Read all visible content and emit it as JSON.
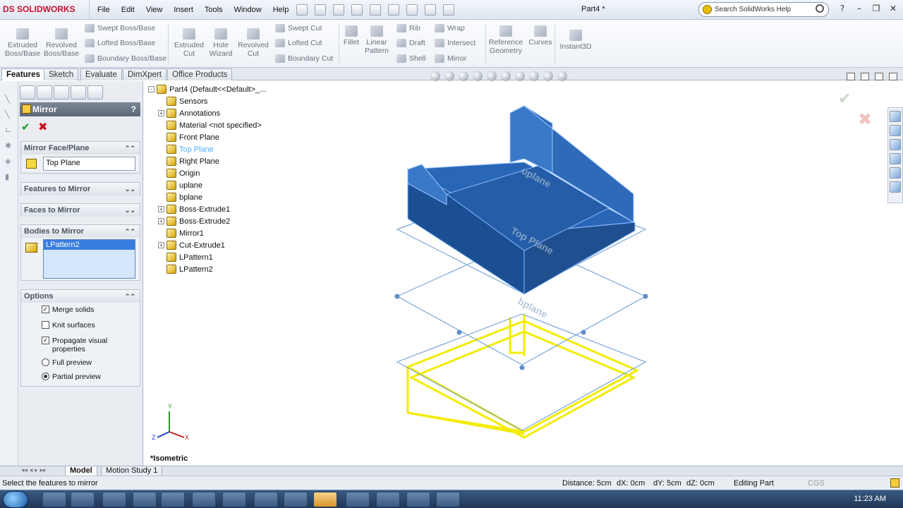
{
  "app": {
    "logo": "SOLIDWORKS",
    "document_title": "Part4 *"
  },
  "menu": [
    "File",
    "Edit",
    "View",
    "Insert",
    "Tools",
    "Window",
    "Help"
  ],
  "search": {
    "placeholder": "Search SolidWorks Help"
  },
  "ribbon": {
    "extruded_boss": "Extruded Boss/Base",
    "revolved_boss": "Revolved Boss/Base",
    "swept_boss": "Swept Boss/Base",
    "lofted_boss": "Lofted Boss/Base",
    "boundary_boss": "Boundary Boss/Base",
    "extruded_cut": "Extruded Cut",
    "hole_wizard": "Hole Wizard",
    "revolved_cut": "Revolved Cut",
    "swept_cut": "Swept Cut",
    "lofted_cut": "Lofted Cut",
    "boundary_cut": "Boundary Cut",
    "fillet": "Fillet",
    "linear_pattern": "Linear Pattern",
    "rib": "Rib",
    "draft": "Draft",
    "shell": "Shell",
    "wrap": "Wrap",
    "intersect": "Intersect",
    "mirror": "Mirror",
    "reference_geometry": "Reference Geometry",
    "curves": "Curves",
    "instant3d": "Instant3D"
  },
  "command_tabs": [
    "Features",
    "Sketch",
    "Evaluate",
    "DimXpert",
    "Office Products"
  ],
  "property_manager": {
    "title": "Mirror",
    "help": "?",
    "mirror_face_plane": {
      "label": "Mirror Face/Plane",
      "value": "Top Plane"
    },
    "features_to_mirror": "Features to Mirror",
    "faces_to_mirror": "Faces to Mirror",
    "bodies_to_mirror": {
      "label": "Bodies to Mirror",
      "items": [
        "LPattern2"
      ]
    },
    "options": {
      "label": "Options",
      "merge_solids": "Merge solids",
      "knit_surfaces": "Knit surfaces",
      "propagate": "Propagate visual properties",
      "full_preview": "Full preview",
      "partial_preview": "Partial preview"
    }
  },
  "tree": [
    {
      "label": "Part4  (Default<<Default>_...",
      "expander": "-"
    },
    {
      "label": "Sensors",
      "expander": ""
    },
    {
      "label": "Annotations",
      "expander": "+"
    },
    {
      "label": "Material <not specified>",
      "expander": ""
    },
    {
      "label": "Front Plane",
      "expander": ""
    },
    {
      "label": "Top Plane",
      "expander": ""
    },
    {
      "label": "Right Plane",
      "expander": ""
    },
    {
      "label": "Origin",
      "expander": ""
    },
    {
      "label": "uplane",
      "expander": ""
    },
    {
      "label": "bplane",
      "expander": ""
    },
    {
      "label": "Boss-Extrude1",
      "expander": "+"
    },
    {
      "label": "Boss-Extrude2",
      "expander": "+"
    },
    {
      "label": "Mirror1",
      "expander": ""
    },
    {
      "label": "Cut-Extrude1",
      "expander": "+"
    },
    {
      "label": "LPattern1",
      "expander": ""
    },
    {
      "label": "LPattern2",
      "expander": ""
    }
  ],
  "viewport": {
    "view_name": "*Isometric",
    "plane_labels": [
      "Top Plane",
      "bplane",
      "uplane"
    ],
    "triad": {
      "x": "X",
      "y": "Y",
      "z": "Z"
    }
  },
  "bottom_tabs": [
    "Model",
    "Motion Study 1"
  ],
  "status": {
    "message": "Select the features to mirror",
    "distance": "Distance: 5cm",
    "dx": "dX: 0cm",
    "dy": "dY: 5cm",
    "dz": "dZ: 0cm",
    "mode": "Editing Part",
    "units": "CGS"
  },
  "taskbar": {
    "clock": "11:23 AM"
  },
  "colors": {
    "model": "#2a66b6",
    "preview": "#f4ec00",
    "plane": "#7aa6d8"
  }
}
